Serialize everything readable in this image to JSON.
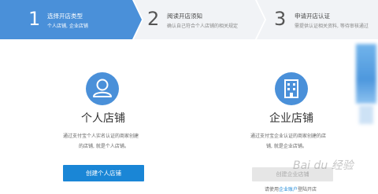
{
  "colors": {
    "accent": "#1a86d6",
    "step_active_bg": "#4a90d9",
    "step_inactive_bg": "#f1f3f6",
    "icon_bg": "#4a90d9"
  },
  "steps": [
    {
      "number": "1",
      "title": "选择开店类型",
      "subtitle": "个人店铺, 企业店铺",
      "active": true
    },
    {
      "number": "2",
      "title": "阅读开店须知",
      "subtitle": "确认自己符合个人店铺的相关规定",
      "active": false
    },
    {
      "number": "3",
      "title": "申请开店认证",
      "subtitle": "需提供认证相关资料, 等待审核通过",
      "active": false
    }
  ],
  "personal": {
    "icon": "person-icon",
    "title": "个人店铺",
    "desc_line1": "通过支付宝个人实名认证的商家创建",
    "desc_line2": "的店铺, 就是个人店铺。",
    "button": "创建个人店铺"
  },
  "enterprise": {
    "icon": "building-icon",
    "title": "企业店铺",
    "desc_line1": "通过支付宝企业认证的商家创建的店",
    "desc_line2": "铺, 就是企业店铺。",
    "button": "创建企业店铺",
    "login_prefix": "请使用",
    "login_link": "企业账户",
    "login_suffix": "登陆开店"
  },
  "watermark": "Bai du 经验"
}
